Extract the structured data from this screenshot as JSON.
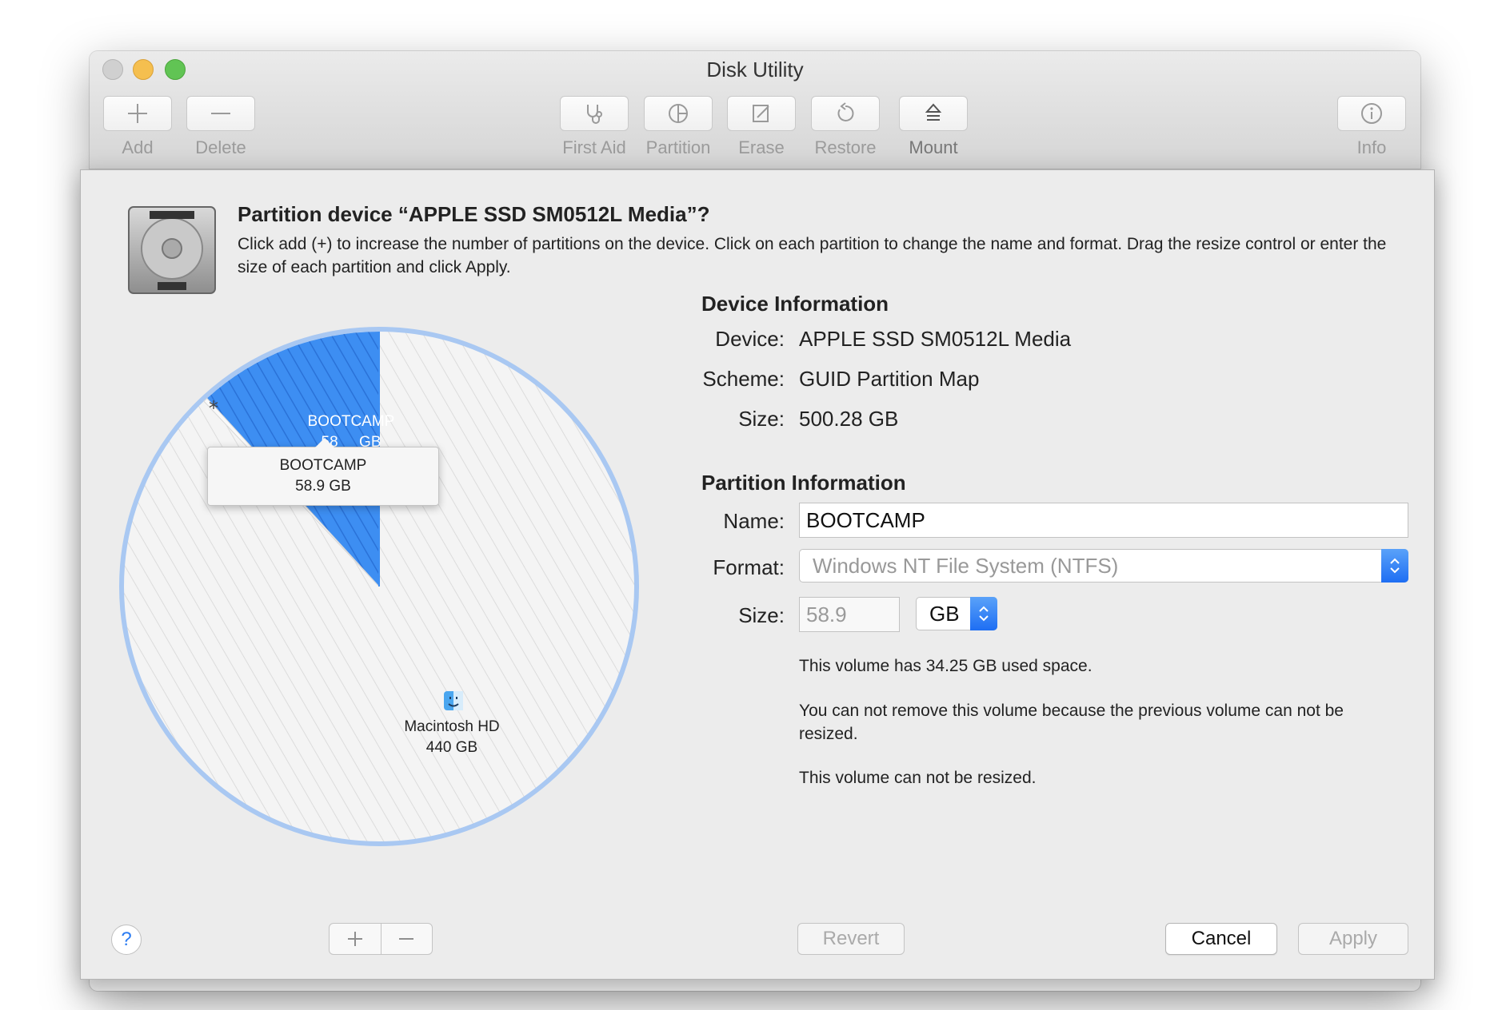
{
  "window": {
    "title": "Disk Utility"
  },
  "toolbar": {
    "add": "Add",
    "delete": "Delete",
    "first_aid": "First Aid",
    "partition": "Partition",
    "erase": "Erase",
    "restore": "Restore",
    "mount": "Mount",
    "info": "Info"
  },
  "sheet": {
    "title": "Partition device “APPLE SSD SM0512L Media”?",
    "description": "Click add (+) to increase the number of partitions on the device. Click on each partition to change the name and format. Drag the resize control or enter the size of each partition and click Apply."
  },
  "pie": {
    "selected_color": "#3d8ef2",
    "unselected_stripe": "#e3e3e3",
    "border_color": "#a9c8f2",
    "free_marker": "*",
    "slices": [
      {
        "name": "BOOTCAMP",
        "size": "58.9 GB",
        "size_label_partial_left": "58",
        "size_label_partial_right": "GB",
        "fraction": 0.1178,
        "selected": true
      },
      {
        "name": "Macintosh HD",
        "size": "440 GB",
        "fraction": 0.8795,
        "selected": false
      }
    ],
    "tooltip": {
      "name": "BOOTCAMP",
      "size": "58.9 GB"
    }
  },
  "device_info": {
    "heading": "Device Information",
    "device_label": "Device:",
    "device_value": "APPLE SSD SM0512L Media",
    "scheme_label": "Scheme:",
    "scheme_value": "GUID Partition Map",
    "size_label": "Size:",
    "size_value": "500.28 GB"
  },
  "partition_info": {
    "heading": "Partition Information",
    "name_label": "Name:",
    "name_value": "BOOTCAMP",
    "format_label": "Format:",
    "format_value": "Windows NT File System (NTFS)",
    "size_label": "Size:",
    "size_value": "58.9",
    "unit_value": "GB",
    "used_note": "This volume has 34.25 GB used space.",
    "remove_note": "You can not remove this volume because the previous volume can not be resized.",
    "resize_note": "This volume can not be resized."
  },
  "buttons": {
    "help": "?",
    "revert": "Revert",
    "cancel": "Cancel",
    "apply": "Apply"
  }
}
